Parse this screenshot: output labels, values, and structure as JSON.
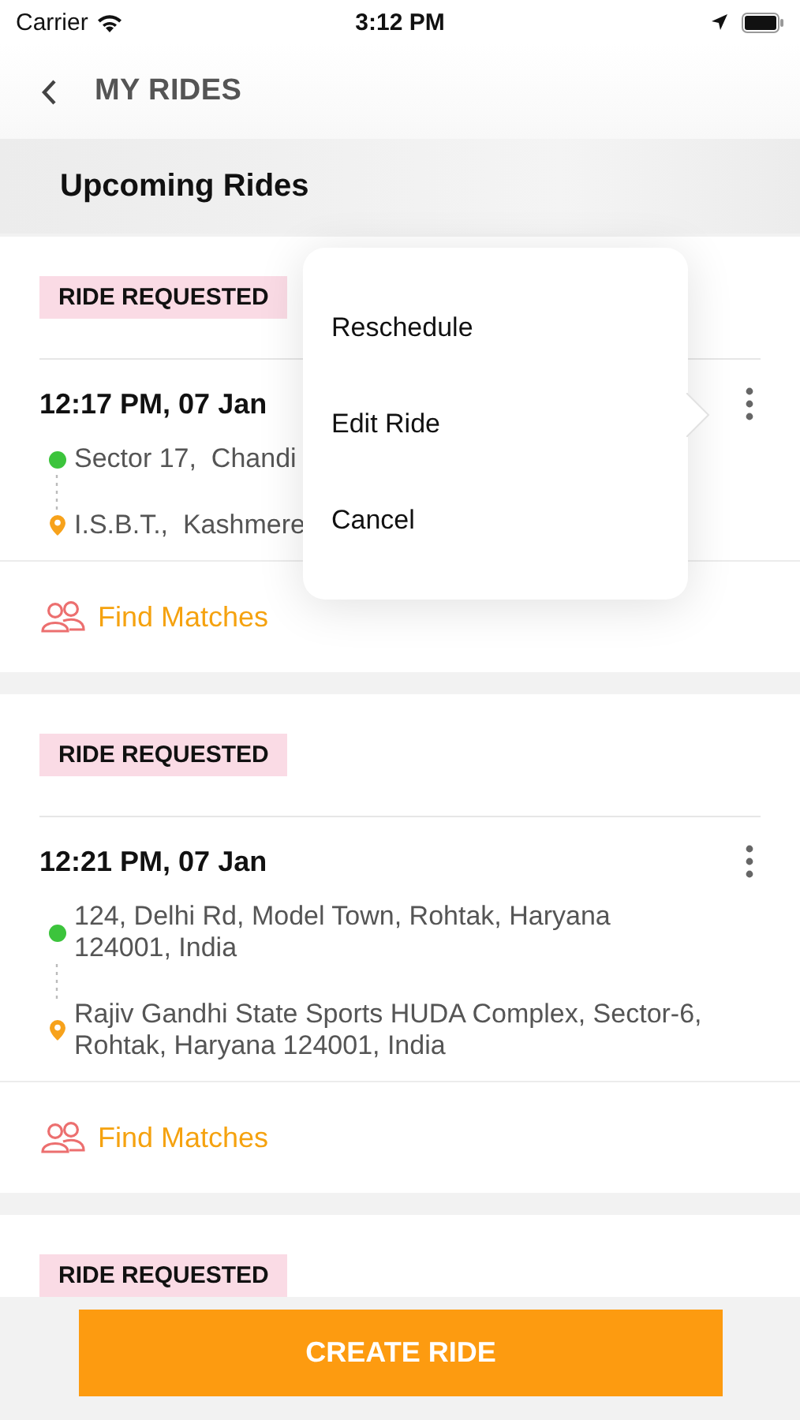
{
  "status_bar": {
    "carrier": "Carrier",
    "time": "3:12 PM"
  },
  "header": {
    "title": "MY RIDES"
  },
  "section": {
    "title": "Upcoming Rides"
  },
  "rides": [
    {
      "status": "RIDE REQUESTED",
      "time": "12:17 PM, 07 Jan",
      "from": "Sector 17,  Chandi",
      "to": "I.S.B.T.,  Kashmere",
      "action": "Find Matches"
    },
    {
      "status": "RIDE REQUESTED",
      "time": "12:21 PM, 07 Jan",
      "from": "124, Delhi Rd, Model Town, Rohtak, Haryana 124001, India",
      "to": "Rajiv Gandhi State Sports HUDA Complex, Sector-6, Rohtak, Haryana 124001, India",
      "action": "Find Matches"
    },
    {
      "status": "RIDE REQUESTED"
    }
  ],
  "menu": {
    "items": [
      "Reschedule",
      "Edit Ride",
      "Cancel"
    ]
  },
  "create_button": "CREATE RIDE"
}
